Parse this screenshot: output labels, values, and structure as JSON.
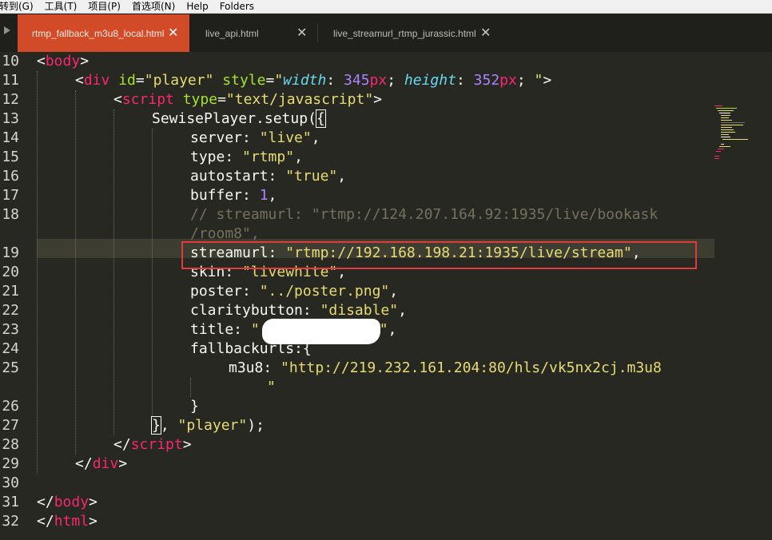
{
  "menu": [
    "转到(G)",
    "工具(T)",
    "项目(P)",
    "首选项(N)",
    "Help",
    "Folders"
  ],
  "tabs": [
    {
      "label": "rtmp_fallback_m3u8_local.html",
      "active": true
    },
    {
      "label": "live_api.html",
      "active": false
    },
    {
      "label": "live_streamurl_rtmp_jurassic.html",
      "active": false
    }
  ],
  "icons": {
    "tab_close": "✕",
    "tab_scroll": "triangle-right"
  },
  "colors": {
    "active_tab": "#d14b28",
    "editor_bg": "#272822",
    "highlight_box": "#e23a3a"
  },
  "line_numbers": [
    "10",
    "11",
    "12",
    "13",
    "14",
    "15",
    "16",
    "17",
    "18",
    "19",
    "20",
    "21",
    "22",
    "23",
    "24",
    "25",
    "26",
    "27",
    "28",
    "29",
    "30",
    "31",
    "32"
  ],
  "code": {
    "l10": {
      "lt": "<",
      "tag": "body",
      "gt": ">"
    },
    "l11": {
      "lt": "<",
      "tag": "div",
      "a1": "id",
      "eq1": "=",
      "v1": "\"player\"",
      "a2": "style",
      "eq2": "=",
      "q1": "\"",
      "p1": "width",
      "c1": ": ",
      "n1": "345",
      "u1": "px",
      "s1": "; ",
      "p2": "height",
      "c2": ": ",
      "n2": "352",
      "u2": "px",
      "s2": "; ",
      "q2": "\"",
      "gt": ">"
    },
    "l12": {
      "lt": "<",
      "tag": "script",
      "a1": "type",
      "eq1": "=",
      "v1": "\"text/javascript\"",
      "gt": ">"
    },
    "l13": {
      "call": "SewisePlayer.setup(",
      "brace": "{"
    },
    "l14": {
      "key": "server: ",
      "val": "\"live\"",
      "tail": ","
    },
    "l15": {
      "key": "type: ",
      "val": "\"rtmp\"",
      "tail": ","
    },
    "l16": {
      "key": "autostart: ",
      "val": "\"true\"",
      "tail": ","
    },
    "l17": {
      "key": "buffer: ",
      "num": "1",
      "tail": ","
    },
    "l18a": {
      "comment": "// streamurl: \"rtmp://124.207.164.92:1935/live/bookask"
    },
    "l18b": {
      "comment": "/room8\","
    },
    "l19": {
      "key": "streamurl: ",
      "val": "\"rtmp://192.168.198.21:1935/live/stream\"",
      "tail": ","
    },
    "l20": {
      "key": "skin: ",
      "val": "\"livewhite\"",
      "tail": ","
    },
    "l21": {
      "key": "poster: ",
      "val": "\"../poster.png\"",
      "tail": ","
    },
    "l22": {
      "key": "claritybutton: ",
      "val": "\"disable\"",
      "tail": ","
    },
    "l23": {
      "key": "title: ",
      "q1": "\"",
      "q2": "\"",
      "tail": ","
    },
    "l24": {
      "key": "fallbackurls:",
      "brace": "{"
    },
    "l25a": {
      "key": "m3u8: ",
      "val": "\"http://219.232.161.204:80/hls/vk5nx2cj.m3u8"
    },
    "l25b": {
      "val": "\""
    },
    "l26": {
      "brace": "}"
    },
    "l27": {
      "brace": "}",
      "rest": ", ",
      "val": "\"player\"",
      "tail": ");"
    },
    "l28": {
      "lt": "</",
      "tag": "script",
      "gt": ">"
    },
    "l29": {
      "lt": "</",
      "tag": "div",
      "gt": ">"
    },
    "l31": {
      "lt": "</",
      "tag": "body",
      "gt": ">"
    },
    "l32": {
      "lt": "</",
      "tag": "html",
      "gt": ">"
    }
  }
}
